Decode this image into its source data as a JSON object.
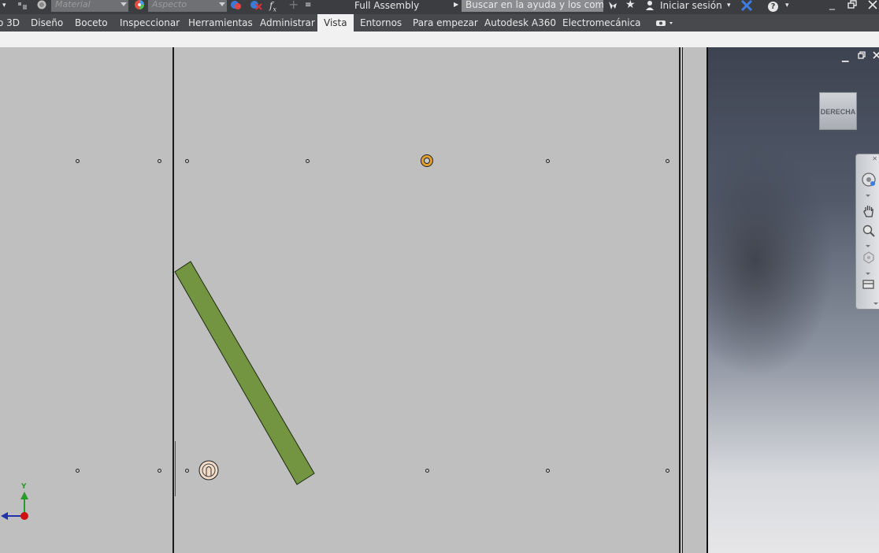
{
  "quick_access": {
    "material_placeholder": "Material",
    "appearance_placeholder": "Aspecto",
    "fx_label": "f",
    "fx_sub": "x",
    "document_title": "Full Assembly",
    "search_placeholder": "Buscar en la ayuda y los comanc",
    "signin_label": "Iniciar sesión",
    "help_icon": "?"
  },
  "ribbon": {
    "tabs": [
      {
        "label": "o 3D"
      },
      {
        "label": "Diseño"
      },
      {
        "label": "Boceto"
      },
      {
        "label": "Inspeccionar"
      },
      {
        "label": "Herramientas"
      },
      {
        "label": "Administrar"
      },
      {
        "label": "Vista",
        "active": true
      },
      {
        "label": "Entornos"
      },
      {
        "label": "Para empezar"
      },
      {
        "label": "Autodesk A360"
      },
      {
        "label": "Electromecánica"
      }
    ]
  },
  "viewport": {
    "viewcube_label": "DERECHA",
    "axis_y_label": "Y",
    "bar_color": "#739440",
    "marker_color": "#e0a030"
  },
  "colors": {
    "titlebar": "#3b3d40",
    "tabbar": "#47494c",
    "canvas": "#bfbfbf"
  }
}
